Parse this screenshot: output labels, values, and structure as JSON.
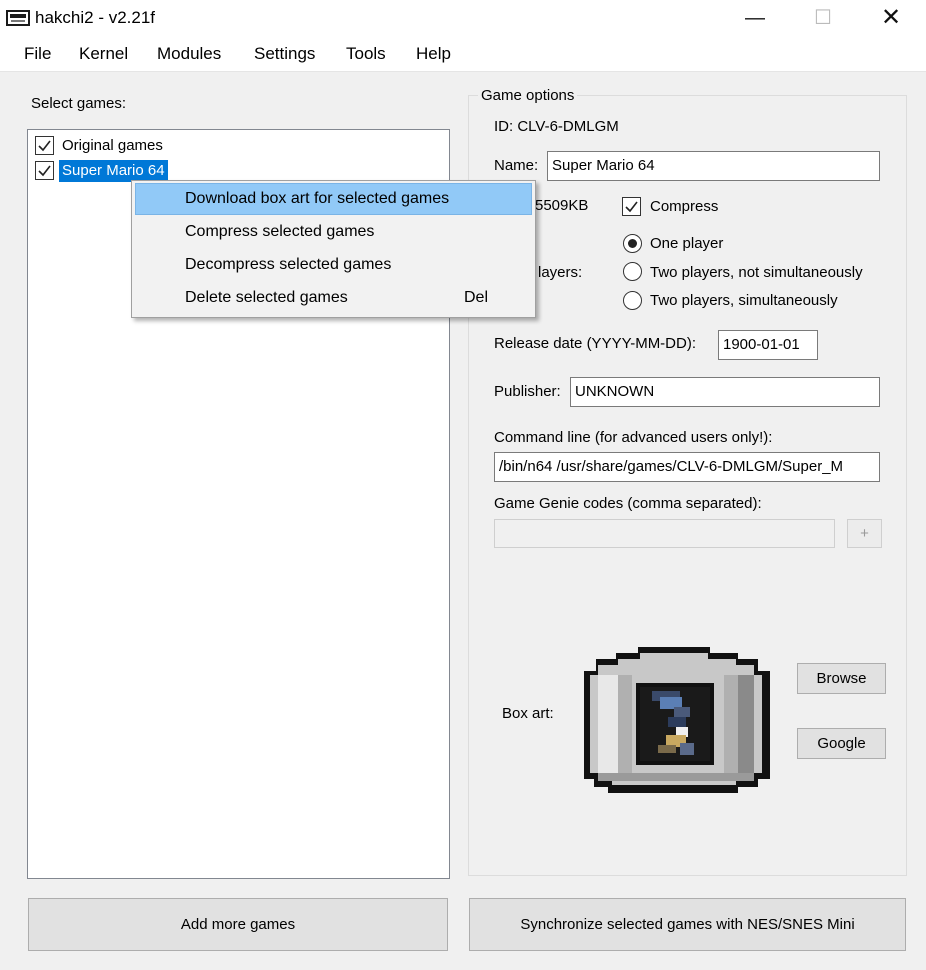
{
  "window": {
    "title": "hakchi2 - v2.21f",
    "controls": {
      "minimize": "—",
      "maximize": "☐",
      "close": "✕"
    }
  },
  "menu": [
    "File",
    "Kernel",
    "Modules",
    "Settings",
    "Tools",
    "Help"
  ],
  "left_pane": {
    "label": "Select games:",
    "games": [
      {
        "label": "Original games",
        "checked": true,
        "selected": false
      },
      {
        "label": "Super Mario 64",
        "checked": true,
        "selected": true
      }
    ]
  },
  "context_menu": {
    "items": [
      {
        "label": "Download box art for selected games",
        "shortcut": "",
        "highlighted": true
      },
      {
        "label": "Compress selected games",
        "shortcut": ""
      },
      {
        "label": "Decompress selected games",
        "shortcut": ""
      },
      {
        "label": "Delete selected games",
        "shortcut": "Del"
      }
    ]
  },
  "game_options": {
    "legend": "Game options",
    "id": "ID: CLV-6-DMLGM",
    "name_label": "Name:",
    "name_value": "Super Mario 64",
    "size_partial": "5509KB",
    "compress_label": "Compress",
    "compress_checked": true,
    "players_partial": "layers:",
    "players_options": [
      {
        "label": "One player",
        "checked": true
      },
      {
        "label": "Two players, not simultaneously",
        "checked": false
      },
      {
        "label": "Two players, simultaneously",
        "checked": false
      }
    ],
    "release_label": "Release date (YYYY-MM-DD):",
    "release_value": "1900-01-01",
    "publisher_label": "Publisher:",
    "publisher_value": "UNKNOWN",
    "cmdline_label": "Command line (for advanced users only!):",
    "cmdline_value": "/bin/n64 /usr/share/games/CLV-6-DMLGM/Super_M",
    "genie_label": "Game Genie codes (comma separated):",
    "genie_value": "",
    "genie_add": "+",
    "boxart_label": "Box art:",
    "browse_label": "Browse",
    "google_label": "Google"
  },
  "buttons": {
    "add_games": "Add more games",
    "sync": "Synchronize selected games with NES/SNES Mini"
  },
  "colors": {
    "selection": "#0078d7",
    "menu_highlight": "#91c9f7",
    "window_bg": "#f0f0f0"
  }
}
